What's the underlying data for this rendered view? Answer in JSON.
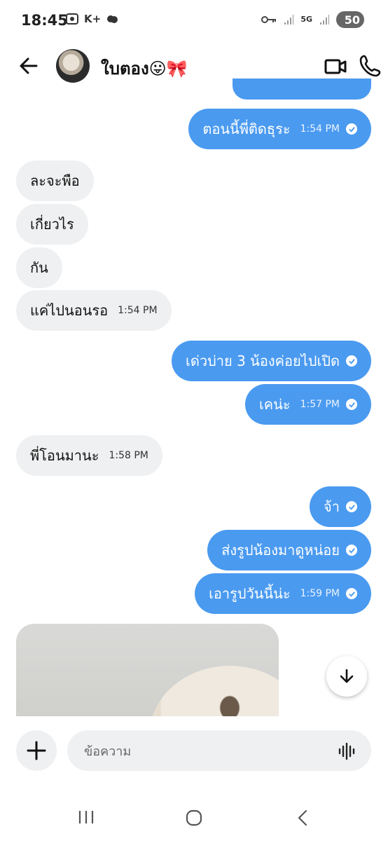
{
  "status_bar": {
    "time": "18:45",
    "carrier_badge": "K+",
    "network": "5G",
    "battery": "50"
  },
  "header": {
    "contact_name": "ใบตอง😛🎀"
  },
  "messages": [
    {
      "dir": "out",
      "text": "",
      "time": "",
      "read": false,
      "clipped": true
    },
    {
      "dir": "out",
      "text": "ตอนนี้พี่ติดธุระ",
      "time": "1:54 PM",
      "read": true
    },
    {
      "dir": "in",
      "text": "ละจะพือ",
      "time": ""
    },
    {
      "dir": "in",
      "text": "เกี่ยวไร",
      "time": ""
    },
    {
      "dir": "in",
      "text": "กัน",
      "time": ""
    },
    {
      "dir": "in",
      "text": "แค่ไปนอนรอ",
      "time": "1:54 PM"
    },
    {
      "dir": "out",
      "text": "เด่วบ่าย 3 น้องค่อยไปเปิด",
      "time": "",
      "read": true
    },
    {
      "dir": "out",
      "text": "เคน่ะ",
      "time": "1:57 PM",
      "read": true
    },
    {
      "dir": "in",
      "text": "พี่โอนมานะ",
      "time": "1:58 PM"
    },
    {
      "dir": "out",
      "text": "จ้า",
      "time": "",
      "read": true
    },
    {
      "dir": "out",
      "text": "ส่งรูปน้องมาดูหน่อย",
      "time": "",
      "read": true
    },
    {
      "dir": "out",
      "text": "เอารูปวันนี้น่ะ",
      "time": "1:59 PM",
      "read": true
    }
  ],
  "composer": {
    "placeholder": "ข้อความ"
  },
  "colors": {
    "outgoing_bubble": "#4a9af0",
    "incoming_bubble": "#eff0f1"
  },
  "icons": [
    "back-arrow-icon",
    "video-call-icon",
    "phone-icon",
    "read-check-icon",
    "arrow-down-icon",
    "plus-icon",
    "voice-wave-icon",
    "recents-icon",
    "home-icon",
    "nav-back-icon"
  ]
}
